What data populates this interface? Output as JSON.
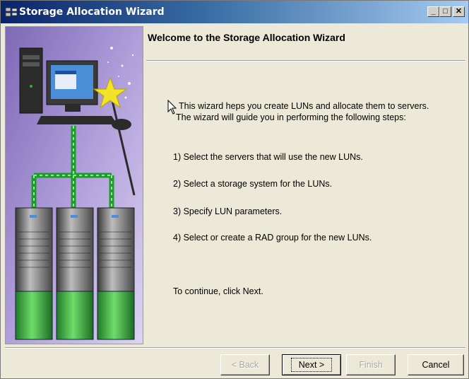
{
  "window": {
    "title": "Storage Allocation Wizard",
    "minimize_label": "_",
    "maximize_label": "□",
    "close_label": "✕"
  },
  "content": {
    "heading": "Welcome to the Storage Allocation Wizard",
    "intro_line1": "This wizard heps you create LUNs and allocate them to servers.",
    "intro_line2": "The wizard will guide you in performing the following steps:",
    "steps": [
      "1)  Select the servers that will use the new LUNs.",
      "2)  Select a storage system for the LUNs.",
      "3)  Specify LUN parameters.",
      "4)  Select or create a RAD group for the new LUNs."
    ],
    "continue_text": "To continue, click Next."
  },
  "buttons": {
    "back": "< Back",
    "next": "Next >",
    "finish": "Finish",
    "cancel": "Cancel"
  },
  "colors": {
    "titlebar_start": "#0a246a",
    "dialog_bg": "#ece9d8",
    "art_purple": "#8a74c0",
    "art_green": "#2fae3a"
  },
  "icons": [
    "app-icon",
    "cursor-icon",
    "star-icon"
  ]
}
